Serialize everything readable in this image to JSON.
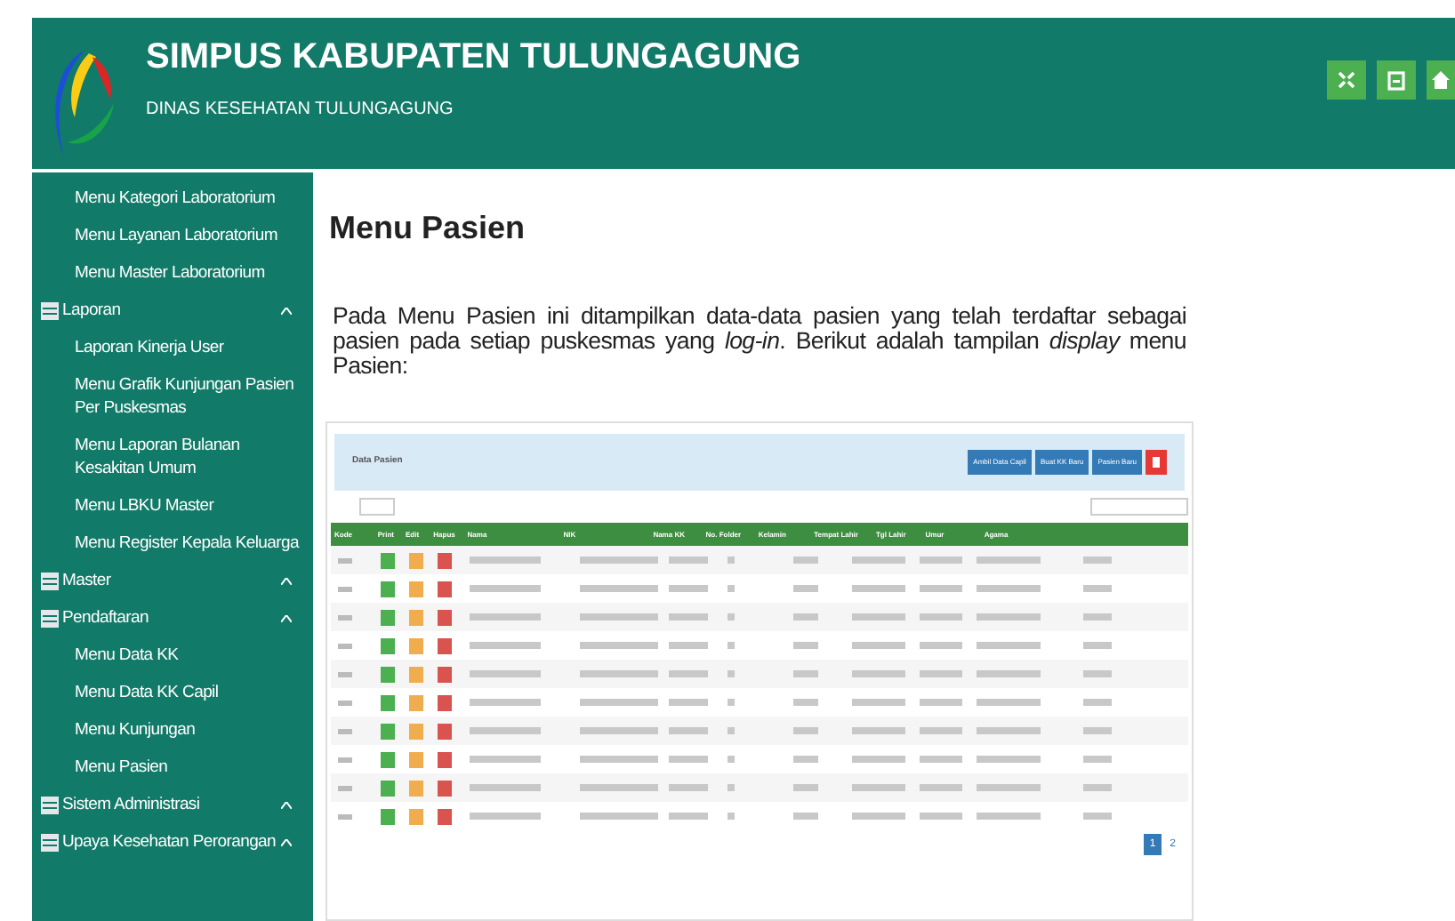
{
  "header": {
    "title": "SIMPUS KABUPATEN TULUNGAGUNG",
    "subtitle": "DINAS KESEHATAN TULUNGAGUNG"
  },
  "sidebar": {
    "items": [
      {
        "kind": "sub",
        "label": "Menu Kategori Laboratorium"
      },
      {
        "kind": "sub",
        "label": "Menu Layanan Laboratorium"
      },
      {
        "kind": "sub",
        "label": "Menu Master Laboratorium"
      },
      {
        "kind": "section",
        "label": "Laporan"
      },
      {
        "kind": "sub",
        "label": "Laporan Kinerja User"
      },
      {
        "kind": "sub",
        "label": "Menu Grafik Kunjungan Pasien Per Puskesmas"
      },
      {
        "kind": "sub",
        "label": "Menu Laporan Bulanan Kesakitan Umum"
      },
      {
        "kind": "sub",
        "label": "Menu LBKU Master"
      },
      {
        "kind": "sub",
        "label": "Menu Register Kepala Keluarga"
      },
      {
        "kind": "section",
        "label": "Master"
      },
      {
        "kind": "section",
        "label": "Pendaftaran"
      },
      {
        "kind": "sub",
        "label": "Menu Data KK"
      },
      {
        "kind": "sub",
        "label": "Menu Data KK Capil"
      },
      {
        "kind": "sub",
        "label": "Menu Kunjungan"
      },
      {
        "kind": "sub",
        "label": "Menu Pasien"
      },
      {
        "kind": "section",
        "label": "Sistem Administrasi"
      },
      {
        "kind": "section",
        "label": "Upaya Kesehatan Perorangan"
      }
    ]
  },
  "content": {
    "heading": "Menu Pasien",
    "paragraph": "Pada Menu Pasien ini ditampilkan data-data pasien yang telah terdaftar sebagai pasien pada setiap puskesmas yang *log-in*. Berikut adalah tampilan *display* menu Pasien:"
  },
  "embedded_screen": {
    "panel_title": "Data Pasien",
    "buttons": [
      "Ambil Data Capil",
      "Buat KK Baru",
      "Pasien Baru"
    ],
    "columns": [
      "Kode",
      "Print",
      "Edit",
      "Hapus",
      "Nama",
      "NIK",
      "Nama KK",
      "No. Folder",
      "Kelamin",
      "Tempat Lahir",
      "Tgl Lahir",
      "Umur",
      "Agama"
    ],
    "rows": [
      {
        "kind": "blurred"
      },
      {
        "kind": "blurred"
      },
      {
        "kind": "blurred"
      },
      {
        "kind": "blurred"
      },
      {
        "kind": "blurred"
      },
      {
        "kind": "blurred"
      },
      {
        "kind": "blurred"
      },
      {
        "kind": "blurred"
      },
      {
        "kind": "blurred"
      },
      {
        "kind": "blurred"
      }
    ],
    "pages": [
      {
        "label": "1",
        "selected": true
      },
      {
        "label": "2",
        "selected": false
      }
    ]
  }
}
